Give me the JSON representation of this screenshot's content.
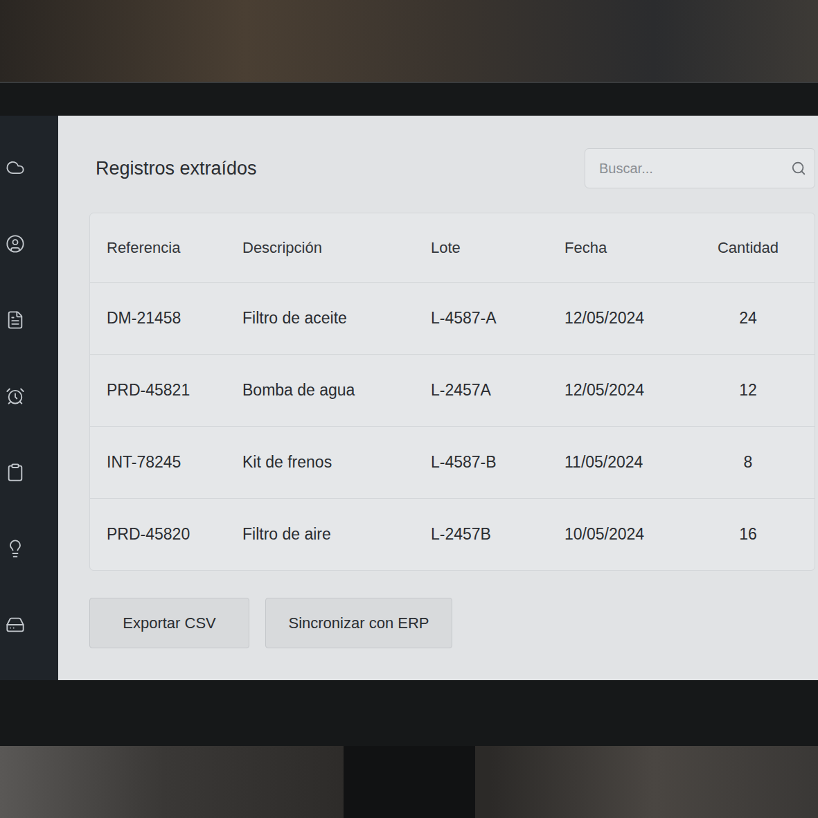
{
  "title": "Registros extraídos",
  "search": {
    "placeholder": "Buscar..."
  },
  "table": {
    "columns": [
      "Referencia",
      "Descripción",
      "Lote",
      "Fecha",
      "Cantidad"
    ],
    "rows": [
      {
        "cells": [
          "DM-21458",
          "Filtro de aceite",
          "L-4587-A",
          "12/05/2024",
          "24"
        ]
      },
      {
        "cells": [
          "PRD-45821",
          "Bomba de agua",
          "L-2457A",
          "12/05/2024",
          "12"
        ]
      },
      {
        "cells": [
          "INT-78245",
          "Kit de frenos",
          "L-4587-B",
          "11/05/2024",
          "8"
        ]
      },
      {
        "cells": [
          "PRD-45820",
          "Filtro de aire",
          "L-2457B",
          "10/05/2024",
          "16"
        ]
      }
    ]
  },
  "buttons": [
    "Exportar CSV",
    "Sincronizar con ERP"
  ]
}
